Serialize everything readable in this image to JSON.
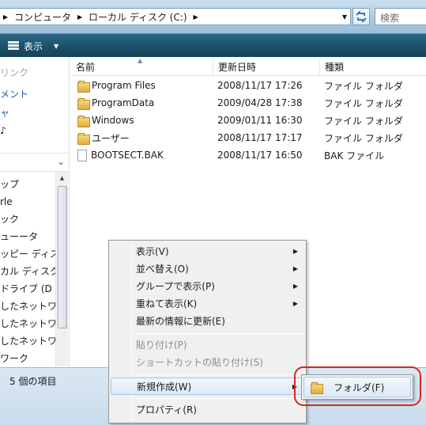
{
  "address": {
    "crumbs": [
      "コンピュータ",
      "ローカル ディスク (C:)"
    ]
  },
  "search": {
    "placeholder": "検索"
  },
  "toolbar": {
    "view_label": "表示"
  },
  "nav": {
    "favorites": [
      "リンク",
      "メント",
      "ャ",
      "♪"
    ],
    "tree": [
      "ップ",
      "rle",
      "ック",
      "ューータ",
      "ッピー ディス",
      "カル ディスク",
      "ドライブ (D",
      "したネットワ",
      "したネットワ",
      "したネットワ",
      "ワーク"
    ]
  },
  "columns": {
    "name": "名前",
    "date": "更新日時",
    "type": "種類"
  },
  "files": [
    {
      "name": "Program Files",
      "date": "2008/11/17 17:26",
      "type": "ファイル フォルダ",
      "kind": "folder"
    },
    {
      "name": "ProgramData",
      "date": "2009/04/28 17:38",
      "type": "ファイル フォルダ",
      "kind": "folder"
    },
    {
      "name": "Windows",
      "date": "2009/01/11 16:30",
      "type": "ファイル フォルダ",
      "kind": "folder"
    },
    {
      "name": "ユーザー",
      "date": "2008/11/17 17:17",
      "type": "ファイル フォルダ",
      "kind": "folder"
    },
    {
      "name": "BOOTSECT.BAK",
      "date": "2008/11/17 16:50",
      "type": "BAK ファイル",
      "kind": "file"
    }
  ],
  "status": {
    "text": "5 個の項目"
  },
  "context_menu": {
    "view": "表示(V)",
    "sort": "並べ替え(O)",
    "group": "グループで表示(P)",
    "stack": "重ねて表示(K)",
    "refresh": "最新の情報に更新(E)",
    "paste": "貼り付け(P)",
    "paste_shortcut": "ショートカットの貼り付け(S)",
    "new": "新規作成(W)",
    "properties": "プロパティ(R)"
  },
  "submenu": {
    "folder": "フォルダ(F)"
  },
  "colors": {
    "highlight_ring": "#d9261c",
    "command_bar": "#1b4f6a"
  }
}
